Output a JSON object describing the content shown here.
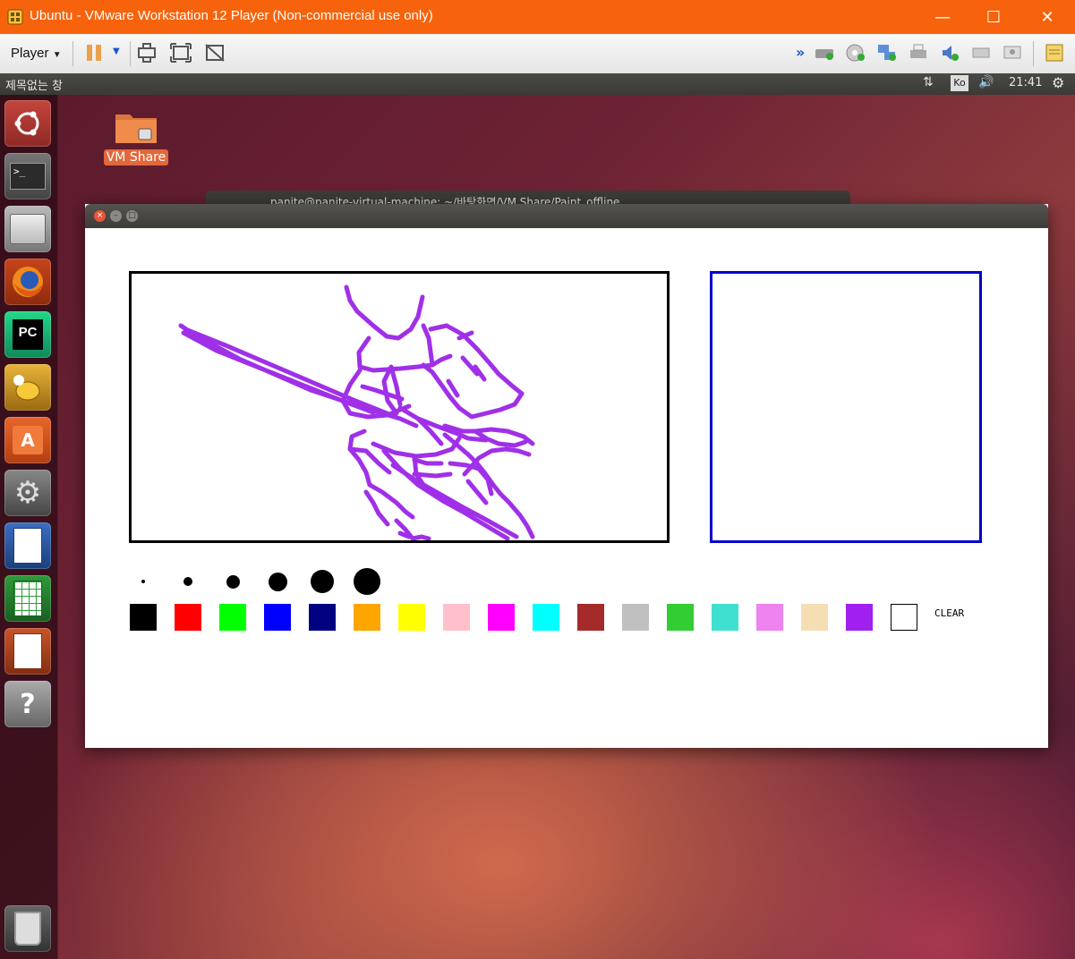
{
  "vmware": {
    "title": "Ubuntu - VMware Workstation 12 Player (Non-commercial use only)",
    "player_menu": "Player"
  },
  "panel": {
    "window_title": "제목없는 창",
    "ime": "Ko",
    "clock": "21:41"
  },
  "desktop": {
    "folder_label": "VM Share",
    "terminal_title": "panite@panite-virtual-machine: ~/바탕화면/VM Share/Paint_offline"
  },
  "launcher": {
    "items": [
      "ubuntu-dash-icon",
      "terminal-icon",
      "files-icon",
      "firefox-icon",
      "pycharm-icon",
      "teapot-icon",
      "software-center-icon",
      "system-settings-icon",
      "writer-icon",
      "calc-icon",
      "impress-icon",
      "help-icon",
      "trash-icon"
    ]
  },
  "paint": {
    "brush_sizes": [
      1,
      2,
      3,
      4,
      5,
      6
    ],
    "colors": [
      "#000000",
      "#ff0000",
      "#00ff00",
      "#0000ff",
      "#000080",
      "#ffa500",
      "#ffff00",
      "#ffc0cb",
      "#ff00ff",
      "#00ffff",
      "#a52a2a",
      "#c0c0c0",
      "#32cd32",
      "#40e0d0",
      "#ee82ee",
      "#f5deb3",
      "#a020f0",
      "#ffffff"
    ],
    "clear_label": "CLEAR",
    "stroke_color": "#a030e8"
  }
}
